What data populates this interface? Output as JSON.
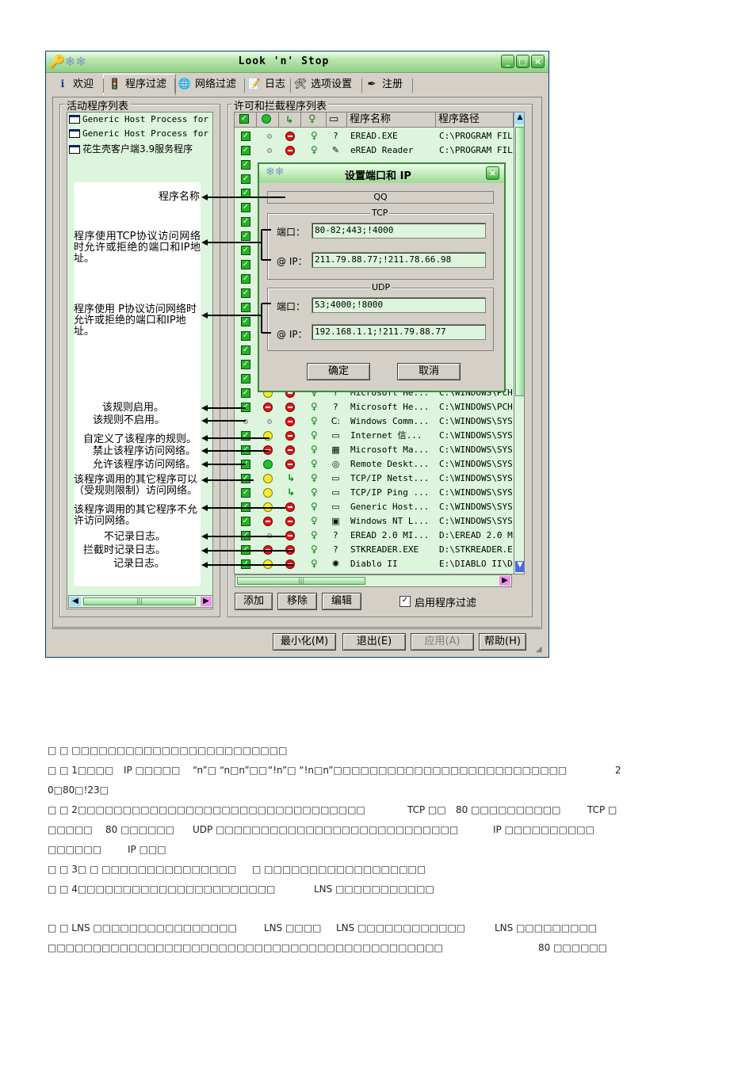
{
  "window": {
    "title": "Look 'n' Stop",
    "tabs": [
      "欢迎",
      "程序过滤",
      "网络过滤",
      "日志",
      "选项设置",
      "注册"
    ],
    "active_tab": "程序过滤"
  },
  "left_group": {
    "label": "活动程序列表",
    "items": [
      "Generic Host Process for W",
      "Generic Host Process for W",
      "花生壳客户端3.9服务程序"
    ]
  },
  "annotations": [
    "程序名称",
    "程序使用TCP协议访问网络时允许或拒绝的端口和IP地址。",
    "程序使用 P协议访问网络时允许或拒绝的端口和IP地址。",
    "该规则启用。",
    "该规则不启用。",
    "自定义了该程序的规则。",
    "禁止该程序访问网络。",
    "允许该程序访问网络。",
    "该程序调用的其它程序可以（受规则限制）访问网络。",
    "该程序调用的其它程序不允许访问网络。",
    "不记录日志。",
    "拦截时记录日志。",
    "记录日志。"
  ],
  "right_group": {
    "label": "许可和拦截程序列表",
    "col_name": "程序名称",
    "col_path": "程序路径",
    "rows": [
      {
        "name": "EREAD.EXE",
        "path": "C:\\PROGRAM FIL"
      },
      {
        "name": "eREAD Reader",
        "path": "C:\\PROGRAM FIL"
      },
      {
        "name": "Microsoft He...",
        "path": "C:\\WINDOWS\\PCH"
      },
      {
        "name": "Microsoft He...",
        "path": "C:\\WINDOWS\\PCH"
      },
      {
        "name": "Windows Comm...",
        "path": "C:\\WINDOWS\\SYS"
      },
      {
        "name": "Internet 信...",
        "path": "C:\\WINDOWS\\SYS"
      },
      {
        "name": "Microsoft Ma...",
        "path": "C:\\WINDOWS\\SYS"
      },
      {
        "name": "Remote Deskt...",
        "path": "C:\\WINDOWS\\SYS"
      },
      {
        "name": "TCP/IP Netst...",
        "path": "C:\\WINDOWS\\SYS"
      },
      {
        "name": "TCP/IP Ping ...",
        "path": "C:\\WINDOWS\\SYS"
      },
      {
        "name": "Generic Host...",
        "path": "C:\\WINDOWS\\SYS"
      },
      {
        "name": "Windows NT L...",
        "path": "C:\\WINDOWS\\SYS"
      },
      {
        "name": "EREAD 2.0 MI...",
        "path": "D:\\EREAD 2.0 M"
      },
      {
        "name": "STKREADER.EXE",
        "path": "D:\\STKREADER.E"
      },
      {
        "name": "Diablo II",
        "path": "E:\\DIABLO II\\D"
      }
    ],
    "add_label": "添加",
    "remove_label": "移除",
    "edit_label": "编辑",
    "enable_filter_label": "启用程序过滤"
  },
  "bottom_buttons": {
    "minimize": "最小化(M)",
    "exit": "退出(E)",
    "apply": "应用(A)",
    "help": "帮助(H)"
  },
  "dialog": {
    "title": "设置端口和 IP",
    "program": "QQ",
    "tcp_label": "TCP",
    "udp_label": "UDP",
    "port_label": "端口：",
    "ip_label": "@ IP：",
    "tcp_port": "80-82;443;!4000",
    "tcp_ip": "211.79.88.77;!211.78.66.98",
    "udp_port": "53;4000;!8000",
    "udp_ip": "192.168.1.1;!211.79.88.77",
    "ok_label": "确定",
    "cancel_label": "取消"
  },
  "doc": {
    "line1": "□ □ □□□□□□□□□□□□□□□□□□□□□□□□",
    "line2a": "□ □ 1□□□□",
    "line2b": "IP □□□□□",
    "line2c": "“n”□ “n□n”□□",
    "line2d": "“!n”□ “!n□n”□□□□□□□□□□□□□□□□□□□□□□□□□□",
    "line2e": "2",
    "line3": "0□80□!23□",
    "line4a": "□ □ 2□□□□□□□□□□□□□□□□□□□□□□□□□□□□□□□□",
    "line4b": "TCP □□",
    "line4c": "80 □□□□□□□□□□",
    "line4d": "TCP □",
    "line5a": "□□□□□",
    "line5b": "80 □□□□□□",
    "line5c": "UDP □□□□□□□□□□□□□□□□□□□□□□□□□□□",
    "line5d": "IP □□□□□□□□□□",
    "line6a": "□□□□□□",
    "line6b": "IP □□□",
    "line7a": "□ □ 3□ □ □□□□□□□□□□□□□□□",
    "line7b": "□ □□□□□□□□□□□□□□□□□□",
    "line8a": "□ □ 4□□□□□□□□□□□□□□□□□□□□□□",
    "line8b": "LNS □□□□□□□□□□□",
    "line9a": "□ □ LNS □□□□□□□□□□□□□□□□",
    "line9b": "LNS □□□□",
    "line9c": "LNS □□□□□□□□□□□□",
    "line9d": "LNS □□□□□□□□□",
    "line10a": "□□□□□□□□□□□□□□□□□□□□□□□□□□□□□□□□□□□□□□□□□□□□",
    "line10b": "80 □□□□□□"
  }
}
